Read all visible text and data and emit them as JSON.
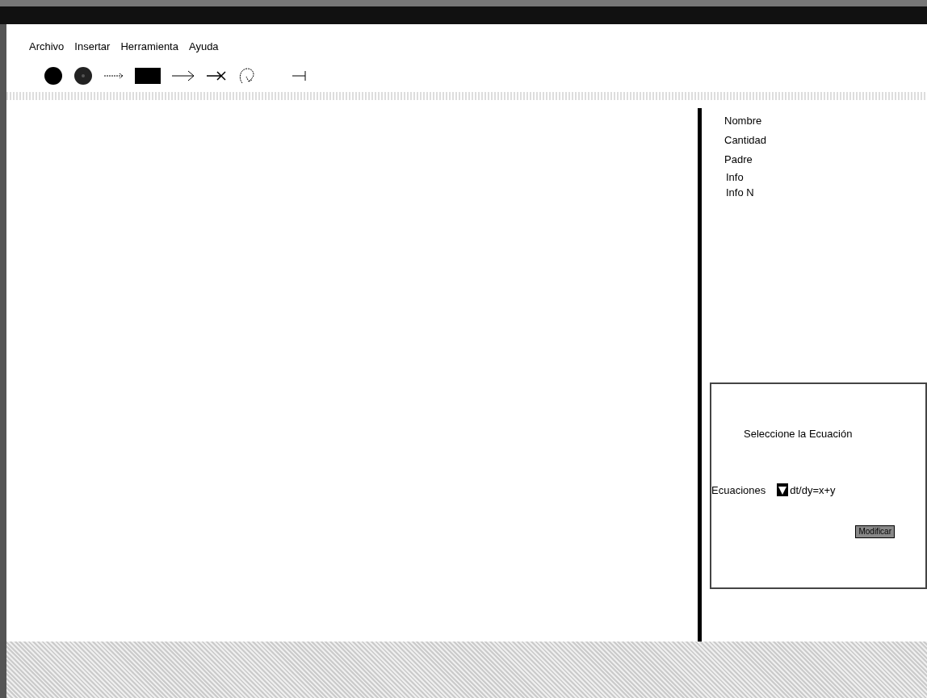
{
  "menu": [
    "Archivo",
    "Insertar",
    "Herramienta",
    "Ayuda"
  ],
  "toolbar": [
    {
      "kind": "circle"
    },
    {
      "kind": "dotted-circle"
    },
    {
      "kind": "dashed-arrow"
    },
    {
      "kind": "square"
    },
    {
      "kind": "arrow"
    },
    {
      "kind": "cross-arrow"
    },
    {
      "kind": "loop"
    },
    {
      "kind": "stop-line"
    }
  ],
  "properties": [
    "Nombre",
    "Cantidad",
    "Padre",
    "Info",
    "Info N"
  ],
  "equation_panel": {
    "title": "Seleccione la Ecuación",
    "label": "Ecuaciones",
    "value": "dt/dy=x+y",
    "button": "Modificar"
  }
}
